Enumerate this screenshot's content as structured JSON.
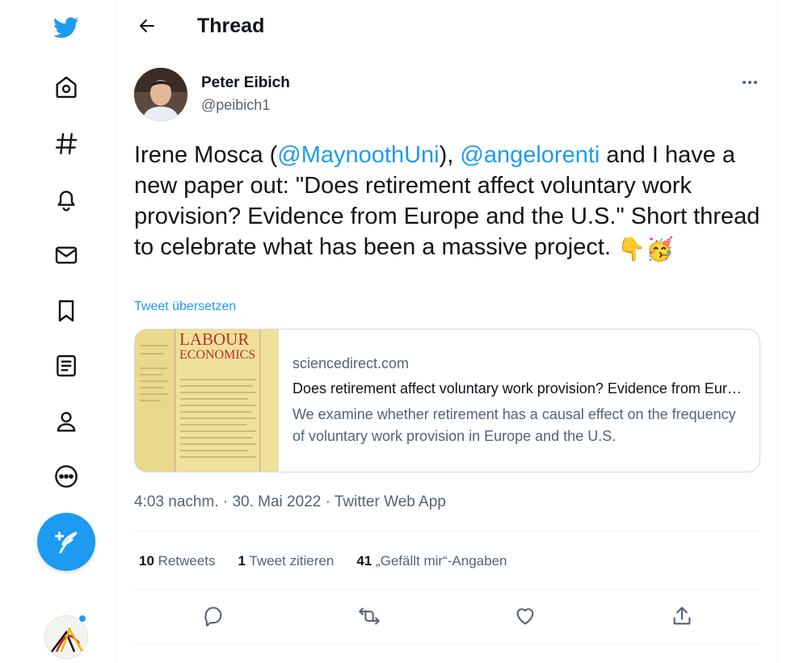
{
  "nav": {
    "items": [
      "twitter-logo",
      "home",
      "explore",
      "notifications",
      "messages",
      "bookmarks",
      "lists",
      "profile",
      "more"
    ],
    "compose_label": "Tweet"
  },
  "header": {
    "title": "Thread",
    "back_icon": "arrow-left-icon"
  },
  "tweet": {
    "author_name": "Peter Eibich",
    "author_handle": "@peibich1",
    "text_1": "Irene Mosca (",
    "mention_1": "@MaynoothUni",
    "text_2": "), ",
    "mention_2": "@angelorenti",
    "text_3": " and I have a new paper out: \"Does retirement affect voluntary work provision? Evidence from Europe and the U.S.\" Short thread to celebrate what has been a massive project. ",
    "emoji_1": "👇",
    "emoji_2": "🥳",
    "translate": "Tweet übersetzen",
    "card": {
      "image_title_1": "LABOUR",
      "image_title_2": "ECONOMICS",
      "domain": "sciencedirect.com",
      "title": "Does retirement affect voluntary work provision? Evidence from Europe and the U.S.",
      "description": "We examine whether retirement has a causal effect on the frequency of voluntary work provision in Europe and the U.S."
    },
    "time": "4:03 nachm.",
    "date": "30. Mai 2022",
    "source": "Twitter Web App",
    "separator": " · ",
    "stats": {
      "retweets_count": "10",
      "retweets_label": "Retweets",
      "quotes_count": "1",
      "quotes_label": "Tweet zitieren",
      "likes_count": "41",
      "likes_label": "„Gefällt mir“-Angaben"
    }
  },
  "colors": {
    "accent": "#1d9bf0",
    "text": "#0f1419",
    "muted": "#536471",
    "border": "#eff3f4"
  }
}
